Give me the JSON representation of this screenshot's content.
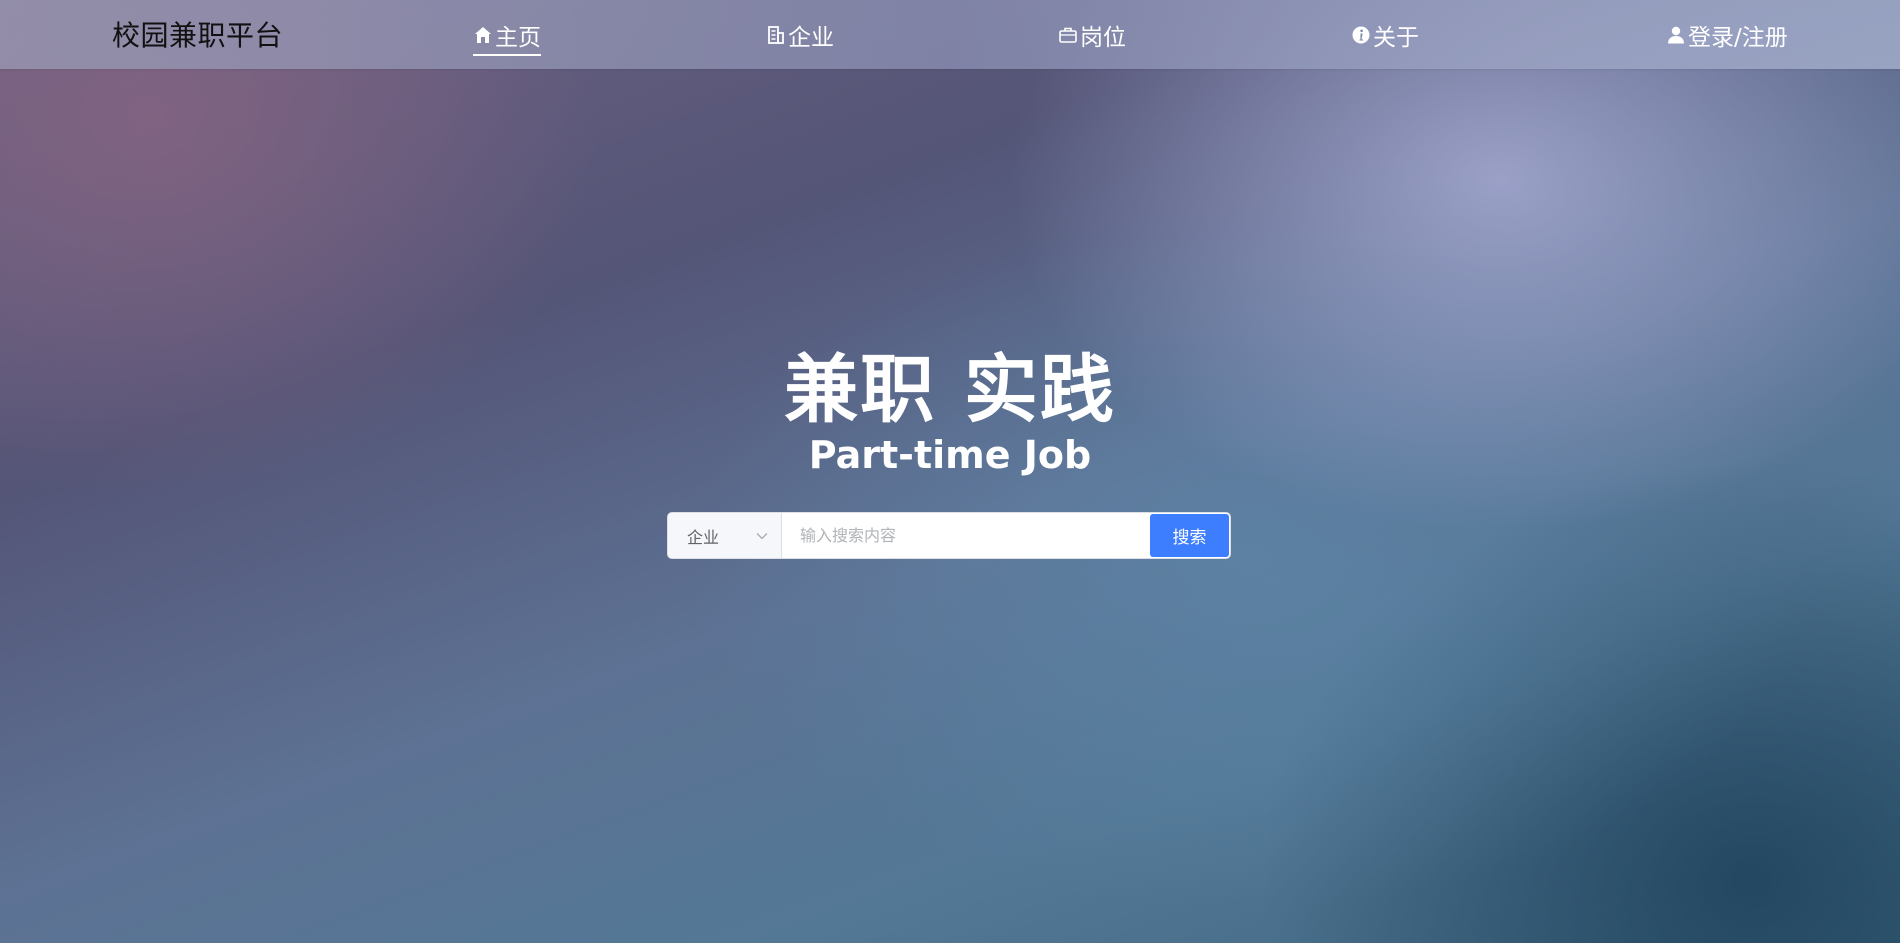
{
  "navbar": {
    "brand": "校园兼职平台",
    "items": [
      {
        "label": "主页",
        "icon": "home-icon",
        "active": true
      },
      {
        "label": "企业",
        "icon": "building-icon",
        "active": false
      },
      {
        "label": "岗位",
        "icon": "briefcase-icon",
        "active": false
      },
      {
        "label": "关于",
        "icon": "info-icon",
        "active": false
      },
      {
        "label": "登录/注册",
        "icon": "user-icon",
        "active": false
      }
    ]
  },
  "hero": {
    "title": "兼职 实践",
    "subtitle": "Part-time Job"
  },
  "search": {
    "category": "企业",
    "placeholder": "输入搜索内容",
    "value": "",
    "button_label": "搜索",
    "icon": "chevron-down-icon"
  },
  "colors": {
    "accent": "#3d7eff",
    "nav_text": "#ffffff",
    "brand_text": "#111111"
  }
}
